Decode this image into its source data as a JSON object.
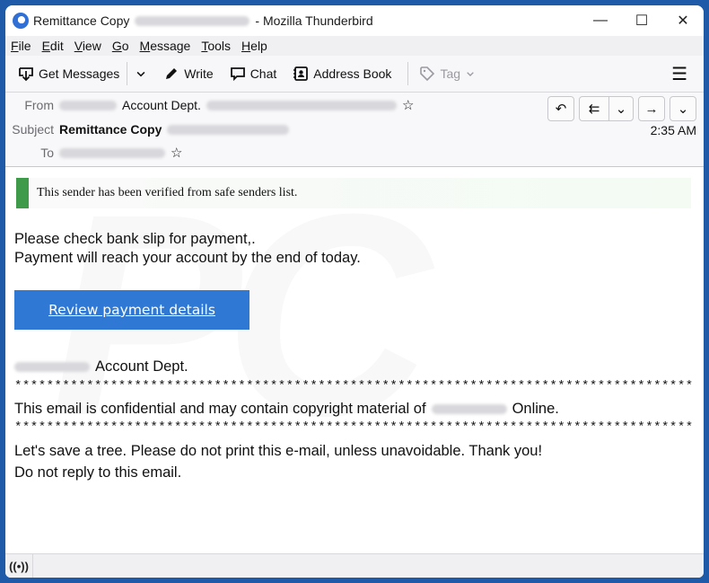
{
  "window": {
    "title_subject": "Remittance Copy",
    "title_app": "- Mozilla Thunderbird",
    "controls": {
      "minimize": "—",
      "maximize": "☐",
      "close": "✕"
    }
  },
  "menubar": {
    "items": [
      {
        "accel": "F",
        "rest": "ile"
      },
      {
        "accel": "E",
        "rest": "dit"
      },
      {
        "accel": "V",
        "rest": "iew"
      },
      {
        "accel": "G",
        "rest": "o"
      },
      {
        "accel": "M",
        "rest": "essage"
      },
      {
        "accel": "T",
        "rest": "ools"
      },
      {
        "accel": "H",
        "rest": "elp"
      }
    ]
  },
  "toolbar": {
    "get_messages": "Get Messages",
    "write": "Write",
    "chat": "Chat",
    "address_book": "Address Book",
    "tag": "Tag",
    "menu_icon": "☰"
  },
  "header": {
    "from_label": "From",
    "from_name": "Account Dept.",
    "subject_label": "Subject",
    "subject": "Remittance Copy",
    "to_label": "To",
    "time": "2:35 AM",
    "actions": {
      "reply": "↶",
      "reply_all": "⇇",
      "forward": "→",
      "more": "⌄"
    }
  },
  "body": {
    "banner": "This sender has been verified from safe senders list.",
    "line1": "Please check bank slip for payment,.",
    "line2": "Payment will reach your account by the end of today.",
    "cta": "Review payment details",
    "signature": "Account Dept.",
    "stars": "***********************************************************************************************************",
    "confidential_pre": "This email is confidential and may contain copyright material of",
    "confidential_post": "Online.",
    "tree": "Let's save a tree. Please do not print this e-mail, unless unavoidable. Thank you!",
    "noreply": "Do not reply to this email."
  },
  "statusbar": {
    "icon": "((•))"
  }
}
